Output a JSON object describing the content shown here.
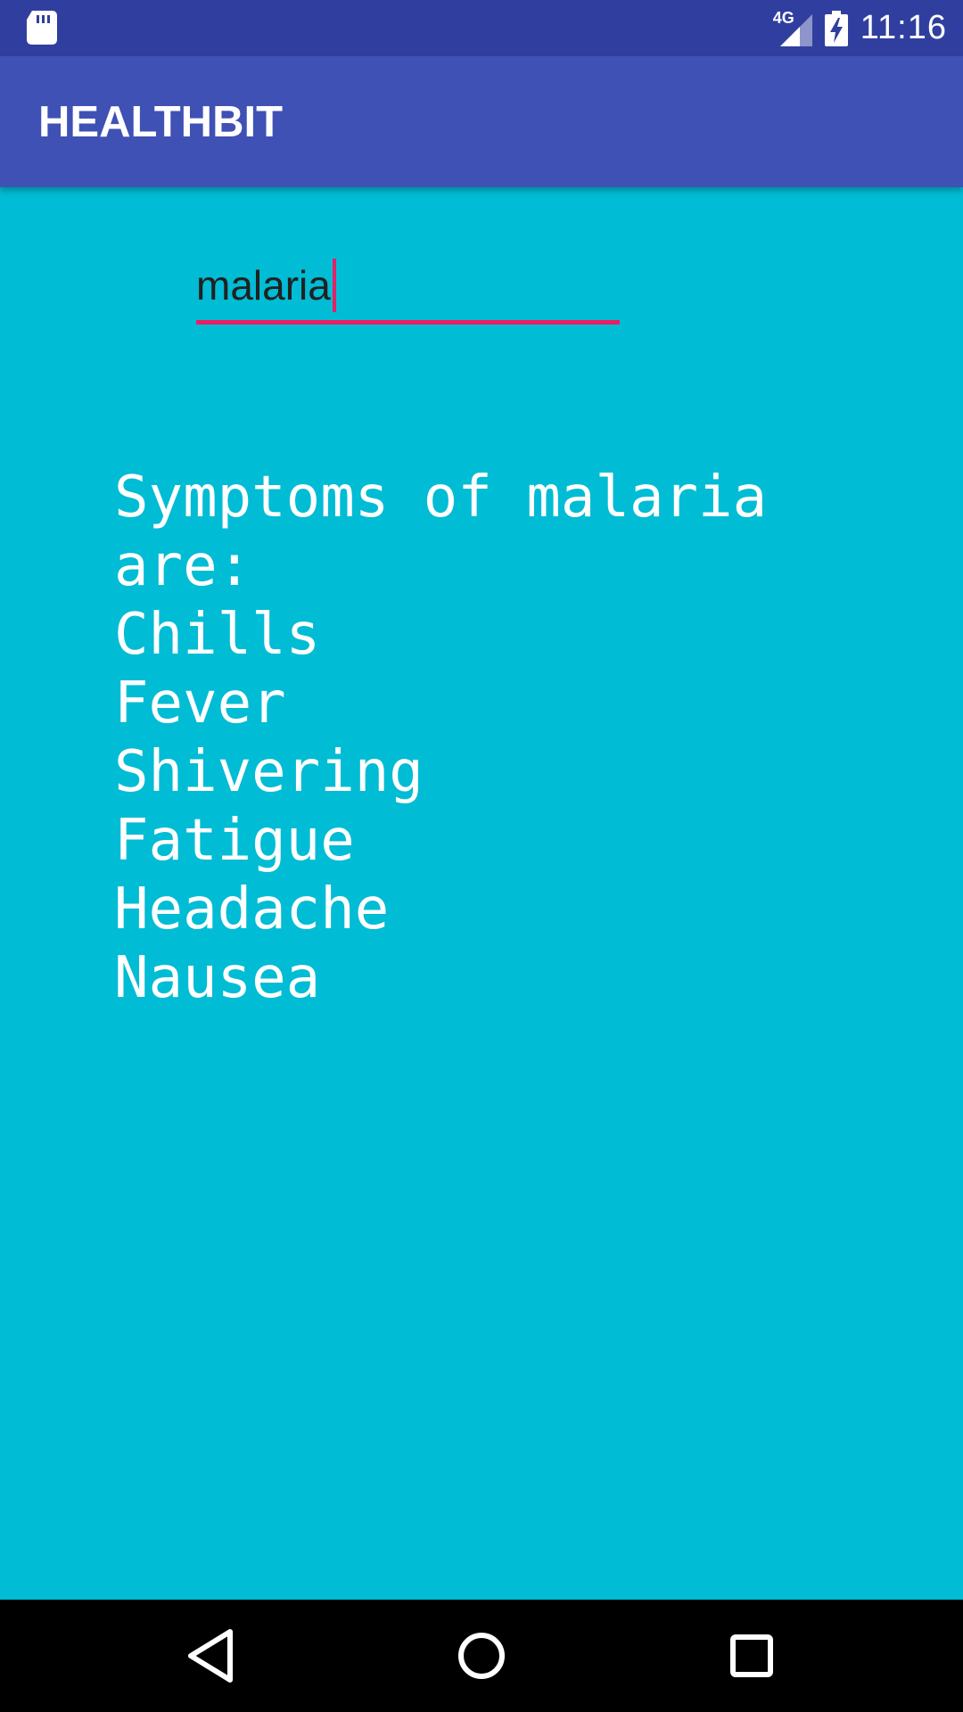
{
  "status_bar": {
    "network_type": "4G",
    "time": "11:16",
    "icons": [
      "sd-card-icon",
      "signal-icon",
      "battery-charging-icon"
    ]
  },
  "app_bar": {
    "title": "HEALTHBIT"
  },
  "search": {
    "value": "malaria"
  },
  "result": {
    "header_line1": "Symptoms of malaria",
    "header_line2": "are:",
    "symptoms": [
      "Chills",
      "Fever",
      "Shivering",
      "Fatigue",
      "Headache",
      "Nausea"
    ]
  },
  "nav_bar": {
    "icons": [
      "back-icon",
      "home-icon",
      "recents-icon"
    ]
  },
  "colors": {
    "status_bar": "#303F9F",
    "app_bar": "#3F51B5",
    "background": "#00BCD4",
    "accent": "#E91E63"
  }
}
